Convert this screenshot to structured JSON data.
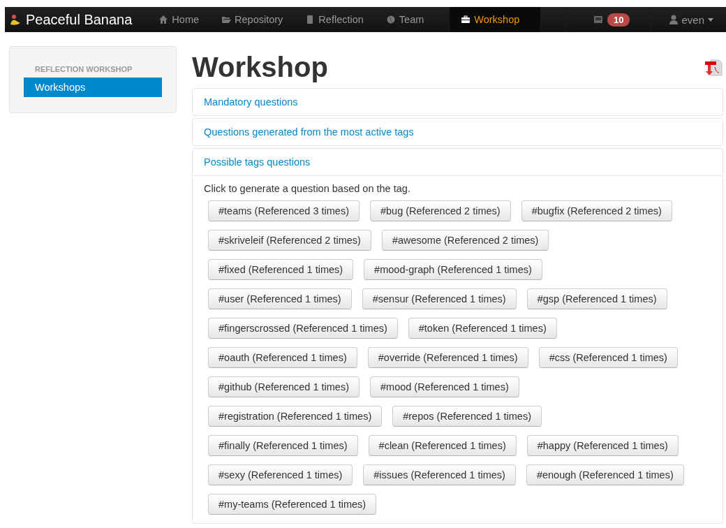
{
  "navbar": {
    "brand": "Peaceful Banana",
    "items": [
      {
        "label": "Home",
        "selected": false
      },
      {
        "label": "Repository",
        "selected": false
      },
      {
        "label": "Reflection",
        "selected": false
      },
      {
        "label": "Team",
        "selected": false
      },
      {
        "label": "Workshop",
        "selected": true
      }
    ],
    "notifications": {
      "count": "10"
    },
    "user": {
      "name": "even"
    }
  },
  "sidebar": {
    "header": "REFLECTION WORKSHOP",
    "items": [
      {
        "label": "Workshops",
        "selected": true
      }
    ]
  },
  "page": {
    "title": "Workshop",
    "panels": [
      {
        "title": "Mandatory questions",
        "expanded": false
      },
      {
        "title": "Questions generated from the most active tags",
        "expanded": false
      },
      {
        "title": "Possible tags questions",
        "expanded": true,
        "intro": "Click to generate a question based on the tag.",
        "tag_rows": [
          [
            "#teams (Referenced 3 times)",
            "#bug (Referenced 2 times)",
            "#bugfix (Referenced 2 times)"
          ],
          [
            "#skriveleif (Referenced 2 times)",
            "#awesome (Referenced 2 times)"
          ],
          [
            "#fixed (Referenced 1 times)",
            "#mood-graph (Referenced 1 times)"
          ],
          [
            "#user (Referenced 1 times)",
            "#sensur (Referenced 1 times)",
            "#gsp (Referenced 1 times)"
          ],
          [
            "#fingerscrossed (Referenced 1 times)",
            "#token (Referenced 1 times)"
          ],
          [
            "#oauth (Referenced 1 times)",
            "#override (Referenced 1 times)",
            "#css (Referenced 1 times)"
          ],
          [
            "#github (Referenced 1 times)",
            "#mood (Referenced 1 times)"
          ],
          [
            "#registration (Referenced 1 times)",
            "#repos (Referenced 1 times)"
          ],
          [
            "#finally (Referenced 1 times)",
            "#clean (Referenced 1 times)",
            "#happy (Referenced 1 times)"
          ],
          [
            "#sexy (Referenced 1 times)",
            "#issues (Referenced 1 times)",
            "#enough (Referenced 1 times)"
          ],
          [
            "#my-teams (Referenced 1 times)"
          ]
        ]
      }
    ]
  }
}
